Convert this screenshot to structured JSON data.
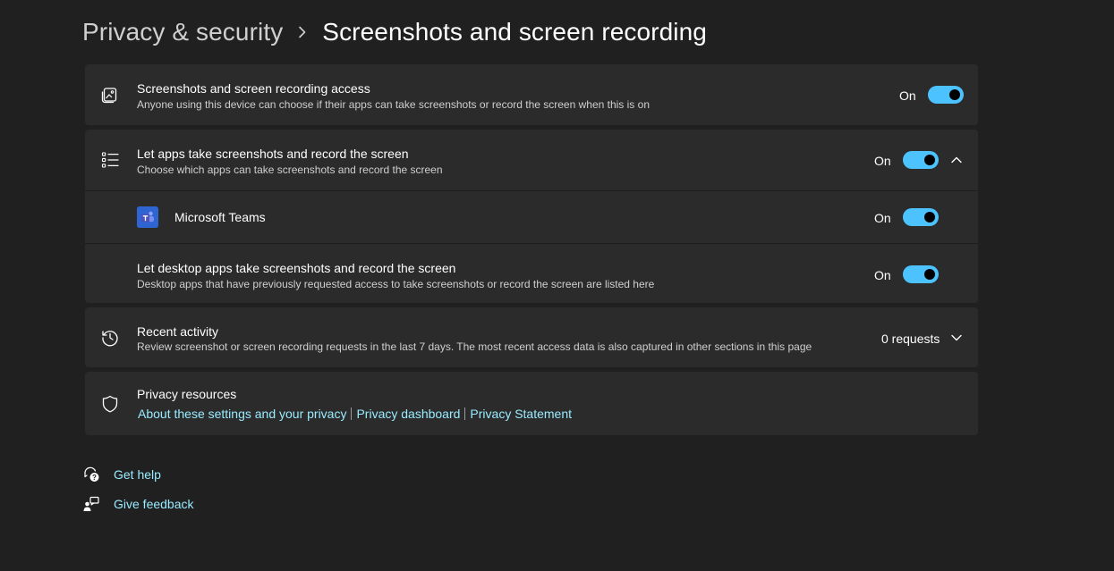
{
  "breadcrumb": {
    "parent": "Privacy & security",
    "current": "Screenshots and screen recording"
  },
  "access": {
    "icon": "screenshot-icon",
    "title": "Screenshots and screen recording access",
    "description": "Anyone using this device can choose if their apps can take screenshots or record the screen when this is on",
    "state_label": "On",
    "toggle_on": true
  },
  "apps": {
    "icon": "list-icon",
    "title": "Let apps take screenshots and record the screen",
    "description": "Choose which apps can take screenshots and record the screen",
    "state_label": "On",
    "toggle_on": true,
    "expanded": true,
    "items": [
      {
        "icon": "microsoft-teams-icon",
        "name": "Microsoft Teams",
        "state_label": "On",
        "toggle_on": true
      }
    ],
    "desktop": {
      "title": "Let desktop apps take screenshots and record the screen",
      "description": "Desktop apps that have previously requested access to take screenshots or record the screen are listed here",
      "state_label": "On",
      "toggle_on": true
    }
  },
  "recent": {
    "icon": "history-icon",
    "title": "Recent activity",
    "description": "Review screenshot or screen recording requests in the last 7 days. The most recent access data is also captured in other sections in this page",
    "count_label": "0 requests"
  },
  "resources": {
    "icon": "shield-icon",
    "title": "Privacy resources",
    "links": [
      "About these settings and your privacy",
      "Privacy dashboard",
      "Privacy Statement"
    ]
  },
  "footer": {
    "help_label": "Get help",
    "feedback_label": "Give feedback"
  },
  "colors": {
    "accent": "#4cc2ff",
    "link": "#99ebff",
    "background": "#202020",
    "card": "#2b2b2b"
  }
}
